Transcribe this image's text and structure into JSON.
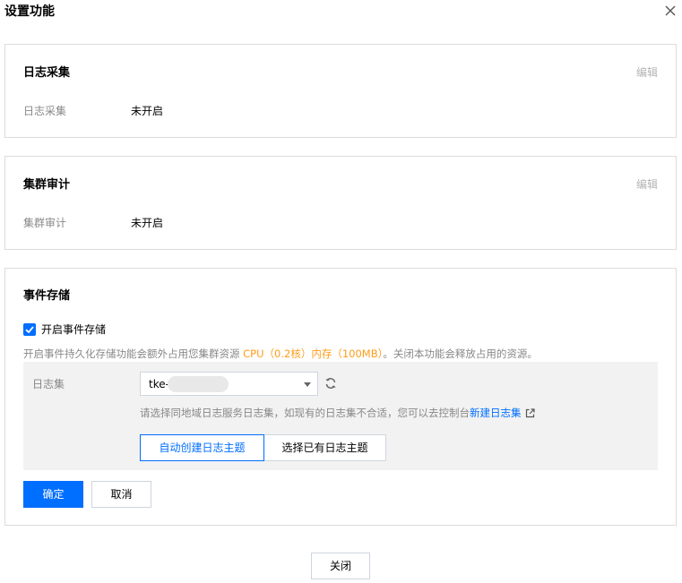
{
  "dialog": {
    "title": "设置功能",
    "close_footer_label": "关闭"
  },
  "log_collection": {
    "title": "日志采集",
    "edit_label": "编辑",
    "field_label": "日志采集",
    "field_value": "未开启"
  },
  "cluster_audit": {
    "title": "集群审计",
    "edit_label": "编辑",
    "field_label": "集群审计",
    "field_value": "未开启"
  },
  "event_storage": {
    "title": "事件存储",
    "checkbox_label": "开启事件存储",
    "checkbox_checked": true,
    "description_prefix": "开启事件持久化存储功能会额外占用您集群资源 ",
    "description_cpu": "CPU（0.2核）",
    "description_memory": "内存（100MB）",
    "description_suffix": "。关闭本功能会释放占用的资源。",
    "logset_label": "日志集",
    "logset_value": "tke-",
    "hint_text": "请选择同地域日志服务日志集，如现有的日志集不合适，您可以去控制台",
    "hint_link": "新建日志集",
    "topic_options": [
      "自动创建日志主题",
      "选择已有日志主题"
    ],
    "topic_selected": "自动创建日志主题",
    "confirm_label": "确定",
    "cancel_label": "取消"
  },
  "colors": {
    "primary": "#006eff",
    "highlight": "#ff9c19",
    "muted_text": "#888888",
    "border": "#dcdcdc"
  },
  "icons": {
    "close": "close-icon",
    "checkbox": "checkmark-icon",
    "dropdown": "caret-down-icon",
    "refresh": "refresh-icon",
    "external_link": "external-link-icon"
  }
}
